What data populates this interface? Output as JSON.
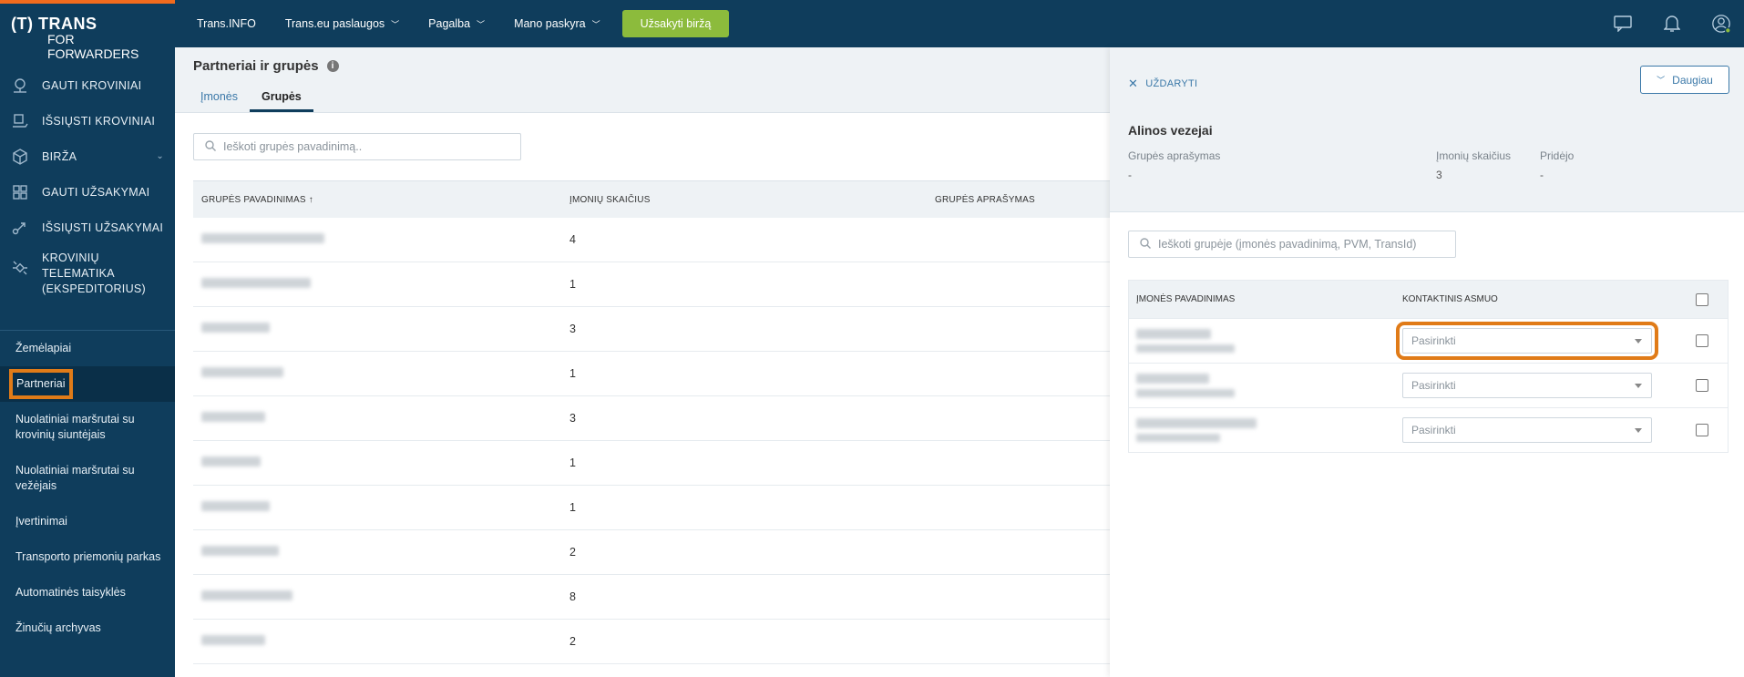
{
  "brand": {
    "logo_line1": "TRANS",
    "logo_line2": "FOR FORWARDERS",
    "logo_mark": "(T)",
    "accent": "#f26b1d",
    "nav_bg": "#0f3d5c",
    "highlight": "#e07b18",
    "cta_green": "#8cbb3c"
  },
  "sidebar": {
    "main_items": [
      {
        "label": "GAUTI KROVINIAI",
        "icon": "cargo-received-icon"
      },
      {
        "label": "IŠSIŲSTI KROVINIAI",
        "icon": "cargo-sent-icon"
      },
      {
        "label": "BIRŽA",
        "icon": "box-icon"
      },
      {
        "label": "GAUTI UŽSAKYMAI",
        "icon": "orders-received-icon"
      },
      {
        "label": "IŠSIŲSTI UŽSAKYMAI",
        "icon": "orders-sent-icon"
      },
      {
        "label": "KROVINIŲ TELEMATIKA (EKSPEDITORIUS)",
        "icon": "satellite-icon"
      }
    ],
    "sub_items": [
      {
        "label": "Žemėlapiai"
      },
      {
        "label": "Partneriai"
      },
      {
        "label": "Nuolatiniai maršrutai su krovinių siuntėjais"
      },
      {
        "label": "Nuolatiniai maršrutai su vežėjais"
      },
      {
        "label": "Įvertinimai"
      },
      {
        "label": "Transporto priemonių parkas"
      },
      {
        "label": "Automatinės taisyklės"
      },
      {
        "label": "Žinučių archyvas"
      }
    ]
  },
  "topbar": {
    "links": [
      "Trans.INFO",
      "Trans.eu paslaugos",
      "Pagalba",
      "Mano paskyra"
    ],
    "cta": "Užsakyti biržą"
  },
  "main": {
    "title": "Partneriai ir grupės",
    "tabs": [
      "Įmonės",
      "Grupės"
    ],
    "search_placeholder": "Ieškoti grupės pavadinimą..",
    "columns": [
      "GRUPĖS PAVADINIMAS ↑",
      "ĮMONIŲ SKAIČIUS",
      "GRUPĖS APRAŠYMAS"
    ],
    "rows": [
      {
        "count": "4"
      },
      {
        "count": "1"
      },
      {
        "count": "3"
      },
      {
        "count": "1"
      },
      {
        "count": "3"
      },
      {
        "count": "1"
      },
      {
        "count": "1"
      },
      {
        "count": "2"
      },
      {
        "count": "8"
      },
      {
        "count": "2"
      }
    ]
  },
  "panel": {
    "close_label": "UŽDARYTI",
    "more_label": "Daugiau",
    "group_name": "Alinos vezejai",
    "desc_label": "Grupės aprašymas",
    "desc_value": "-",
    "count_label": "Įmonių skaičius",
    "count_value": "3",
    "added_label": "Pridėjo",
    "added_value": "-",
    "search_placeholder": "Ieškoti grupėje (įmonės pavadinimą, PVM, TransId)",
    "columns": [
      "ĮMONĖS PAVADINIMAS",
      "KONTAKTINIS ASMUO"
    ],
    "rows": [
      {
        "contact": "Pasirinkti"
      },
      {
        "contact": "Pasirinkti"
      },
      {
        "contact": "Pasirinkti"
      }
    ]
  }
}
